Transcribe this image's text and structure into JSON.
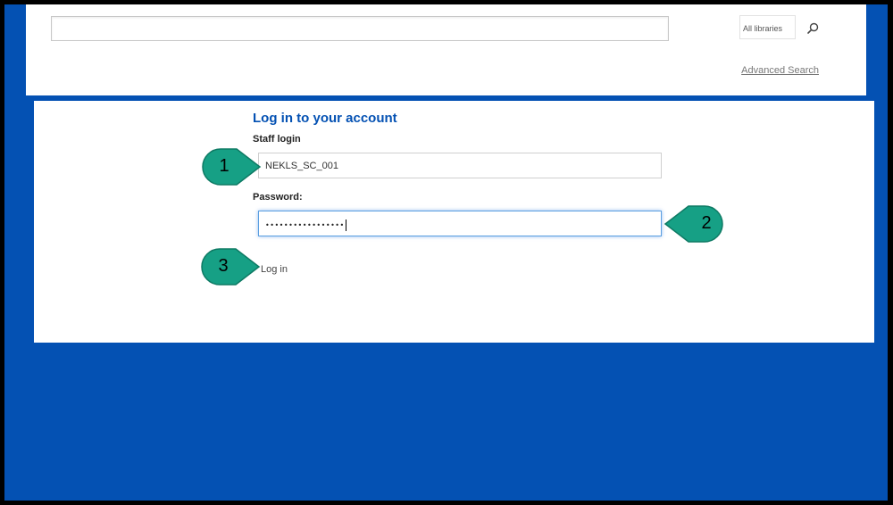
{
  "header": {
    "search_value": "",
    "library_select": "All libraries",
    "search_button_icon": "search-icon",
    "advanced_search_label": "Advanced Search"
  },
  "login": {
    "heading": "Log in to your account",
    "staff_login_label": "Staff login",
    "staff_login_value": "NEKLS_SC_001",
    "password_label": "Password:",
    "password_value": "•••••••••••••••••",
    "login_button_label": "Log in"
  },
  "callouts": [
    "1",
    "2",
    "3"
  ],
  "colors": {
    "page_background": "#0451b3",
    "heading": "#0451b3",
    "callout_fill": "#16a085"
  }
}
